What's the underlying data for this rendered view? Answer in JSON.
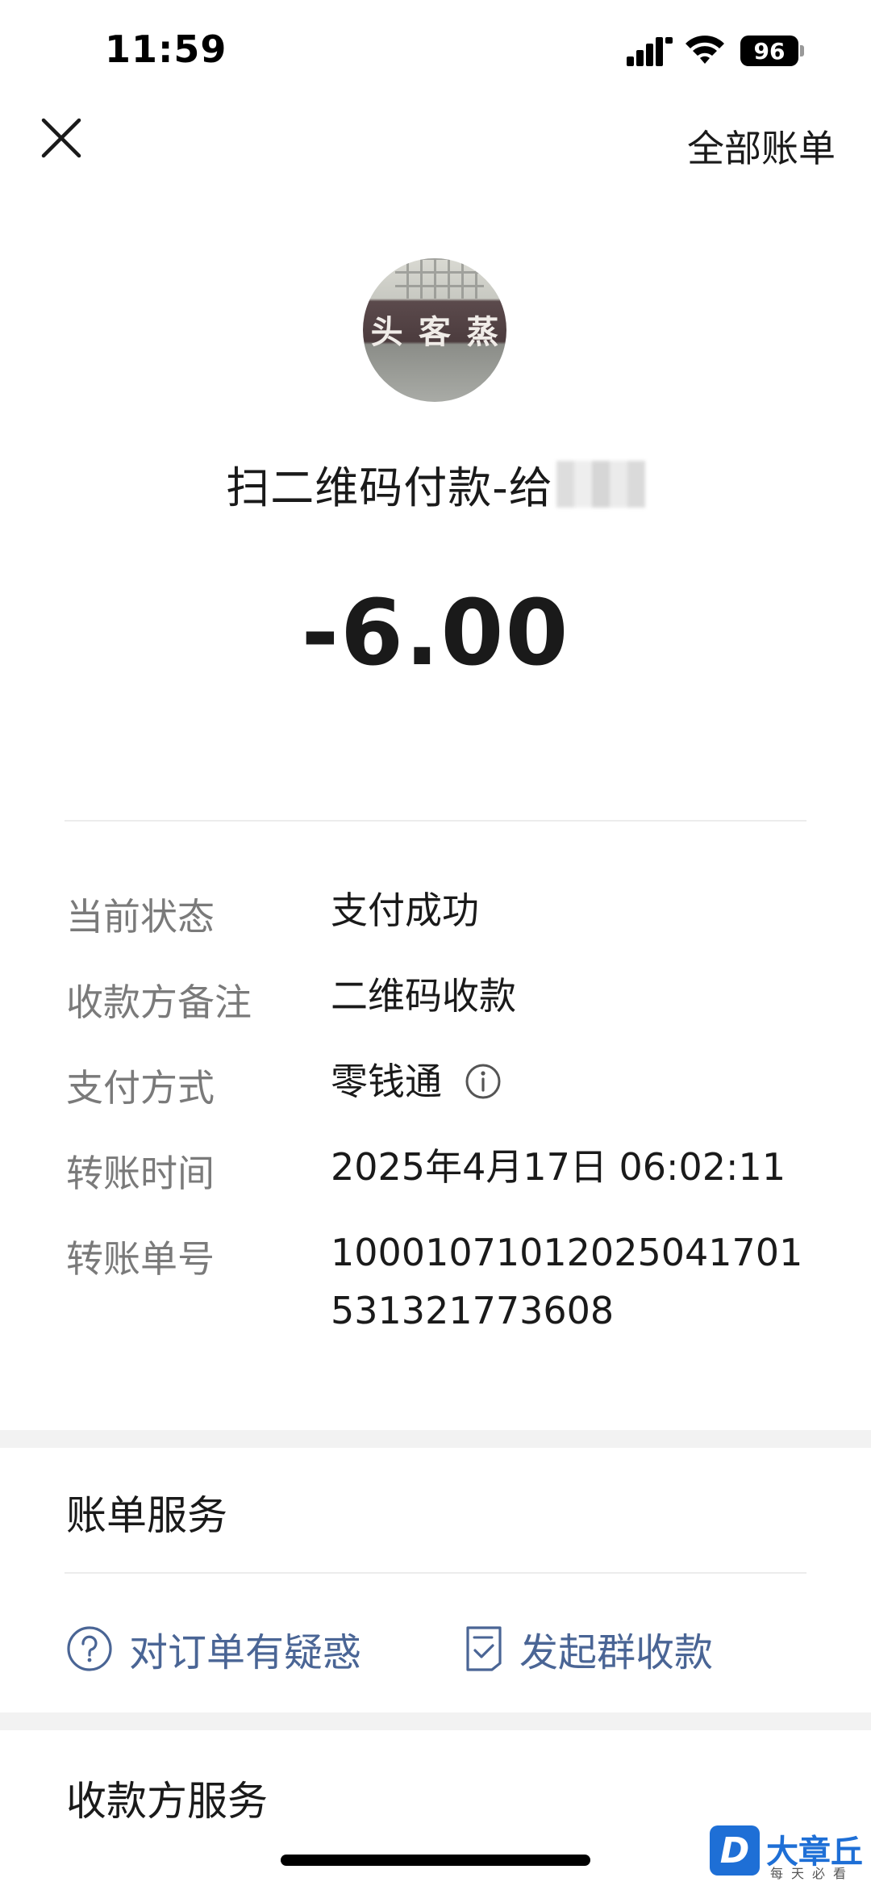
{
  "status_bar": {
    "time": "11:59",
    "battery": "96",
    "icons": [
      "signal-icon",
      "wifi-icon",
      "battery-icon"
    ]
  },
  "nav": {
    "close_icon": "close-icon",
    "all_bills": "全部账单"
  },
  "payee": {
    "avatar_sign_chars": [
      "头",
      "客",
      "蒸"
    ]
  },
  "transaction": {
    "title": "扫二维码付款-给",
    "amount": "-6.00"
  },
  "details": [
    {
      "label": "当前状态",
      "value": "支付成功"
    },
    {
      "label": "收款方备注",
      "value": "二维码收款"
    },
    {
      "label": "支付方式",
      "value": "零钱通",
      "icon": "info-icon"
    },
    {
      "label": "转账时间",
      "value": "2025年4月17日 06:02:11"
    },
    {
      "label": "转账单号",
      "value_line1": "1000107101202504170​1",
      "value_line2": "531321773608"
    }
  ],
  "bill_service": {
    "title": "账单服务",
    "items": [
      {
        "label": "对订单有疑惑",
        "icon": "question-icon"
      },
      {
        "label": "发起群收款",
        "icon": "receipt-icon"
      }
    ]
  },
  "payee_service": {
    "title": "收款方服务"
  },
  "watermark": {
    "logo": "D",
    "name": "大章丘",
    "slogan": "每天必看"
  },
  "colors": {
    "text": "#1a1a1a",
    "label": "#7a7a7a",
    "link": "#4a6595",
    "band": "#f2f2f2"
  }
}
